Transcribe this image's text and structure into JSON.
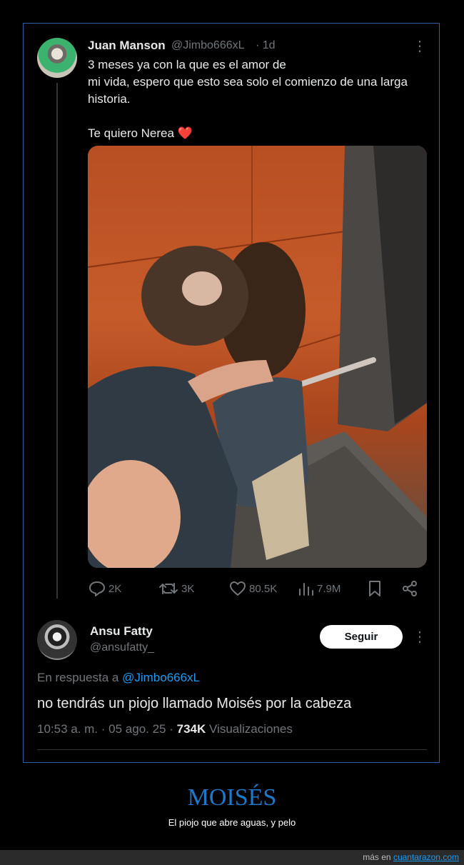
{
  "tweet": {
    "author_name": "Juan Manson",
    "author_handle": "@Jimbo666xL",
    "time": "· 1d",
    "lines": [
      "3 meses ya con la que es el amor de",
      "mi vida, espero que esto sea solo el comienzo de una larga",
      "historia."
    ],
    "signoff": "Te quiero Nerea",
    "signoff_emoji": "❤️",
    "stats": {
      "replies": "2K",
      "retweets": "3K",
      "likes": "80.5K",
      "views": "7.9M"
    }
  },
  "reply": {
    "author_name": "Ansu Fatty",
    "author_handle": "@ansufatty_",
    "follow_label": "Seguir",
    "in_reply_prefix": "En respuesta a",
    "in_reply_mention": "@Jimbo666xL",
    "text": "no tendrás un piojo llamado Moisés por la cabeza",
    "timestamp": "10:53 a. m. · 05 ago. 25 ·",
    "views_count": "734K",
    "views_label": "Visualizaciones"
  },
  "caption": {
    "title": "MOISÉS",
    "subtitle": "El piojo que abre aguas, y pelo"
  },
  "footer": {
    "prefix": "más en",
    "site": "cuantarazon.com"
  },
  "icons": {
    "reply": "reply-icon",
    "retweet": "retweet-icon",
    "like": "heart-icon",
    "views": "views-icon",
    "bookmark": "bookmark-icon",
    "share": "share-icon",
    "more": "more-icon"
  },
  "colors": {
    "accent": "#1d9bf0",
    "muted": "#71767b",
    "caption_title": "#1e78c8",
    "frame_border": "#2f5fa8"
  }
}
